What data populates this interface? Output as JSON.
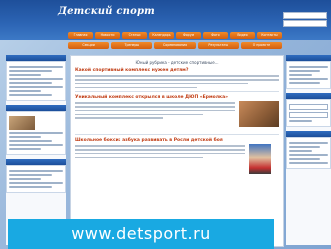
{
  "site": {
    "logo_text": "Детский спорт",
    "url_caption": "www.detsport.ru"
  },
  "nav": {
    "tabs_row1": [
      "Главная",
      "Новости",
      "Статьи",
      "Календарь",
      "Форум",
      "Фото",
      "Видео",
      "Контакты"
    ],
    "tabs_row2": [
      "Секции",
      "Тренеры",
      "Соревнования",
      "Результаты",
      "О проекте"
    ]
  },
  "main": {
    "section_title": "Юный рубрика - детские спортивные...",
    "articles": [
      {
        "title": "Какой спортивный комплекс нужен детям?"
      },
      {
        "title": "Уникальный комплекс открылся в школе ДЮП «Ермолка»"
      },
      {
        "title": "Школьное бокси: азбука развивать в Росли детской боя"
      }
    ]
  },
  "colors": {
    "header_blue": "#1e4f9a",
    "tab_orange": "#d35f0f",
    "banner_cyan": "#19a9e2"
  }
}
